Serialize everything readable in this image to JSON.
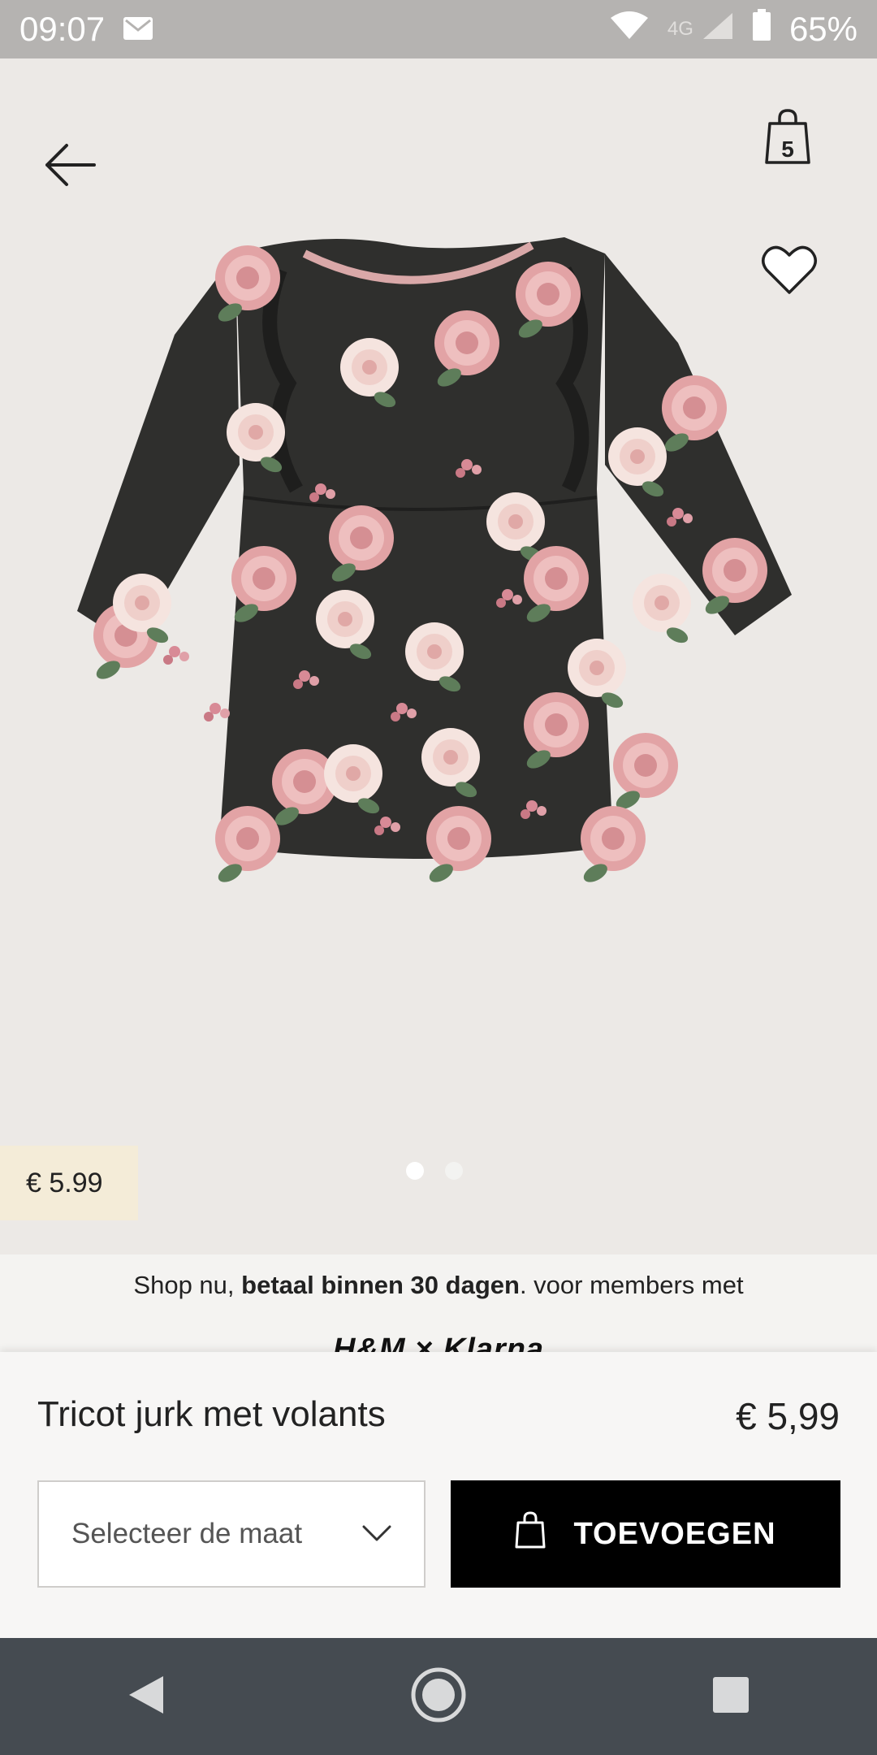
{
  "status_bar": {
    "time": "09:07",
    "network": "4G",
    "battery": "65%"
  },
  "header": {
    "bag_count": "5"
  },
  "gallery": {
    "image_count": 2,
    "active_index": 0
  },
  "price_badge": "€ 5.99",
  "promo": {
    "prefix": "Shop nu, ",
    "emphasis": "betaal binnen 30 dagen",
    "suffix": ". voor members met",
    "partner_logo": "H&M × Klarna"
  },
  "product": {
    "title": "Tricot jurk met volants",
    "price": "€ 5,99"
  },
  "size_select": {
    "placeholder": "Selecteer de maat"
  },
  "add_button": {
    "label": "TOEVOEGEN"
  },
  "colors": {
    "accent": "#000000",
    "price_badge_bg": "#f4ecd8",
    "dress": "#2f2f2d",
    "rose": "#e2a3a5"
  }
}
